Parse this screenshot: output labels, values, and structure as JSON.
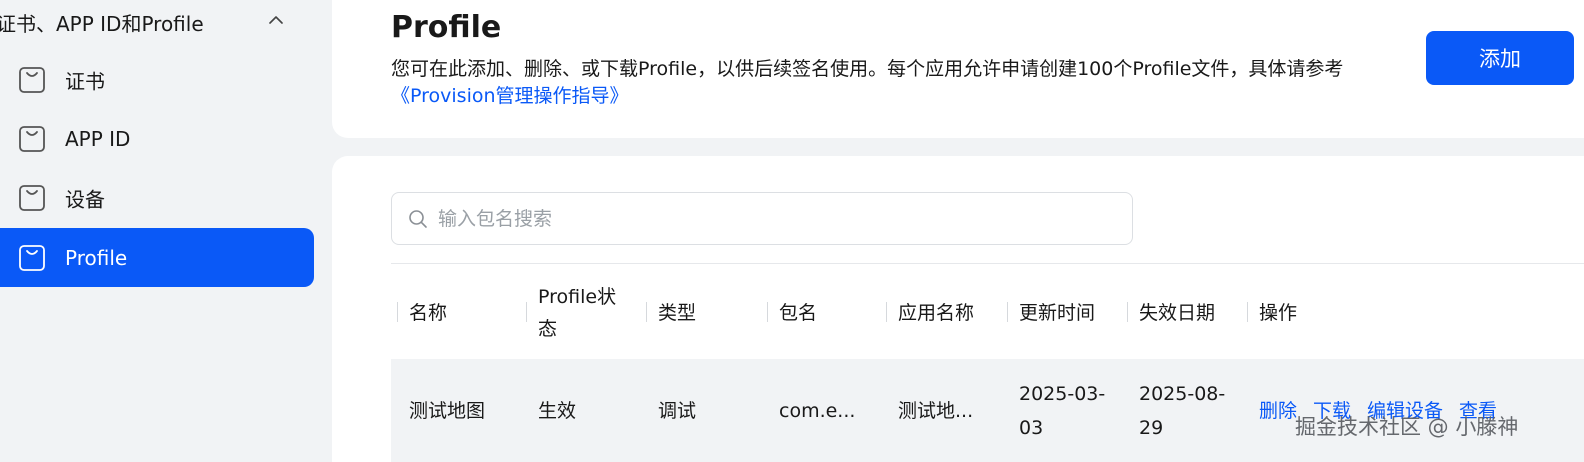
{
  "sidebar": {
    "group_title": "证书、APP ID和Profile",
    "items": [
      {
        "label": "证书",
        "active": false
      },
      {
        "label": "APP ID",
        "active": false
      },
      {
        "label": "设备",
        "active": false
      },
      {
        "label": "Profile",
        "active": true
      }
    ]
  },
  "header": {
    "title": "Profile",
    "description": "您可在此添加、删除、或下载Profile，以供后续签名使用。每个应用允许申请创建100个Profile文件，具体请参考",
    "link_text": "《Provision管理操作指导》",
    "add_button": "添加"
  },
  "search": {
    "placeholder": "输入包名搜索",
    "value": ""
  },
  "table": {
    "columns": [
      "名称",
      "Profile状态",
      "类型",
      "包名",
      "应用名称",
      "更新时间",
      "失效日期",
      "操作"
    ],
    "rows": [
      {
        "name": "测试地图",
        "status": "生效",
        "type": "调试",
        "package": "com.e...",
        "app_name": "测试地...",
        "updated": "2025-03-03",
        "expires": "2025-08-29",
        "actions": [
          "删除",
          "下载",
          "编辑设备",
          "查看"
        ]
      }
    ]
  },
  "watermark": "掘金技术社区 @ 小滕神",
  "colors": {
    "accent": "#0a59f7",
    "sidebar_bg": "#f1f3f5",
    "card_bg": "#ffffff"
  },
  "icons": {
    "nav_item": "bag-icon",
    "collapse": "chevron-up-icon",
    "search": "search-icon"
  }
}
